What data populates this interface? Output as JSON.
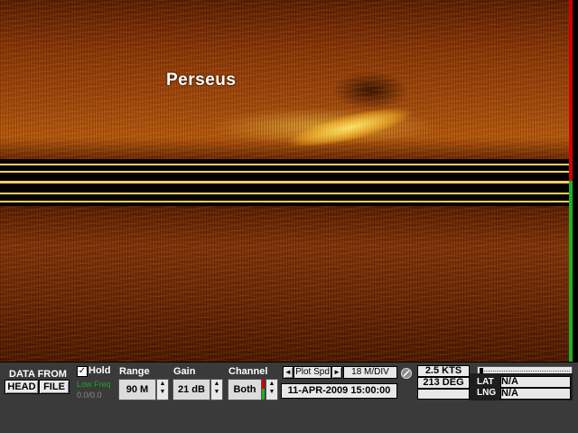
{
  "sonar": {
    "target_label": "Perseus"
  },
  "controls": {
    "data_from": {
      "label": "DATA FROM",
      "head_button": "HEAD",
      "file_button": "FILE"
    },
    "hold": {
      "label": "Hold",
      "checked": true,
      "low_freq": "Low Freq",
      "counter": "0.0/0.0"
    },
    "range": {
      "label": "Range",
      "value": "90 M"
    },
    "gain": {
      "label": "Gain",
      "value": "21 dB"
    },
    "channel": {
      "label": "Channel",
      "value": "Both"
    },
    "plot_speed": {
      "label": "Plot Spd",
      "prev": "◄",
      "next": "►",
      "value": "18 M/DIV"
    },
    "datetime": "11-APR-2009  15:00:00",
    "speed": "2.5 KTS",
    "heading": "213 DEG",
    "lat": {
      "label": "LAT",
      "value": "N/A"
    },
    "lng": {
      "label": "LNG",
      "value": "N/A"
    }
  },
  "colors": {
    "panel_bg": "#3a3a3a",
    "sonar_tint": "#b4560e",
    "port_bar": "#d00000",
    "starboard_bar": "#20b020",
    "low_freq_text": "#1fa81f"
  },
  "icons": {
    "compass": "compass-icon",
    "spin_up": "spin-up-icon",
    "spin_down": "spin-down-icon"
  }
}
